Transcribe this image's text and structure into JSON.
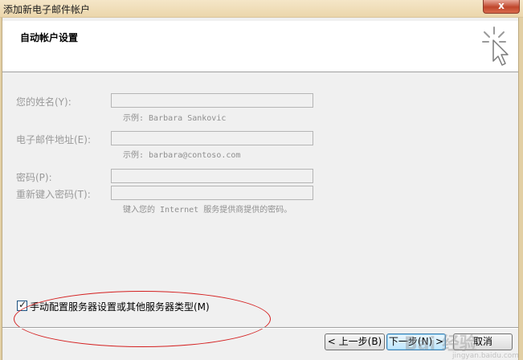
{
  "window": {
    "title": "添加新电子邮件帐户",
    "close_label": "x"
  },
  "header": {
    "title": "自动帐户设置",
    "icon": "cursor-click-icon"
  },
  "form": {
    "name": {
      "label": "您的姓名(Y):",
      "value": "",
      "hint": "示例: Barbara Sankovic"
    },
    "email": {
      "label": "电子邮件地址(E):",
      "value": "",
      "hint": "示例: barbara@contoso.com"
    },
    "password": {
      "label": "密码(P):",
      "value": ""
    },
    "password_confirm": {
      "label": "重新键入密码(T):",
      "value": "",
      "hint": "键入您的 Internet 服务提供商提供的密码。"
    }
  },
  "manual_config": {
    "label": "手动配置服务器设置或其他服务器类型(M)",
    "checked": true,
    "check_glyph": "✓"
  },
  "buttons": {
    "back": "< 上一步(B)",
    "next": "下一步(N) >",
    "cancel": "取消"
  },
  "watermark": {
    "text": "Bai 经验",
    "sub": "jingyan.baidu.com"
  },
  "colors": {
    "title_bar": "#ebd6ab",
    "annotation_oval": "#d42020",
    "disabled_text": "#9a9a9a",
    "next_button": "#bde6fd"
  }
}
